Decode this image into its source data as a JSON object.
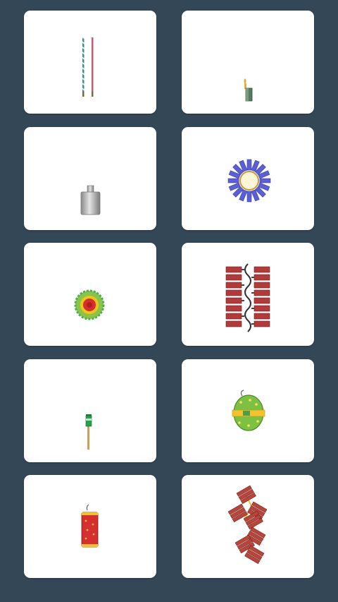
{
  "background": "#344757",
  "cards": [
    {
      "icon": "sparkler-sticks-icon"
    },
    {
      "icon": "candle-firecracker-icon"
    },
    {
      "icon": "silver-shell-icon"
    },
    {
      "icon": "purple-wheel-icon"
    },
    {
      "icon": "ground-spinner-icon"
    },
    {
      "icon": "firecracker-string-icon"
    },
    {
      "icon": "rocket-icon"
    },
    {
      "icon": "green-bomb-icon"
    },
    {
      "icon": "red-cylinder-cracker-icon"
    },
    {
      "icon": "cracker-chain-icon"
    }
  ]
}
